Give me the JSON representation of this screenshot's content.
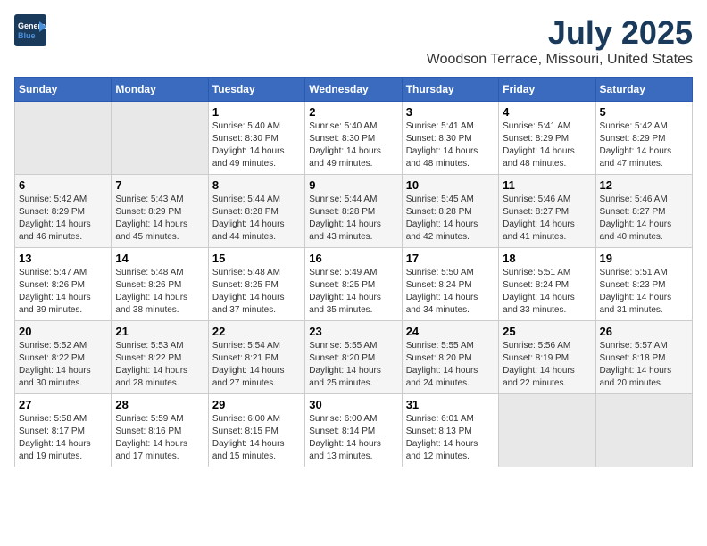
{
  "header": {
    "logo_line1": "General",
    "logo_line2": "Blue",
    "month_title": "July 2025",
    "location": "Woodson Terrace, Missouri, United States"
  },
  "days_of_week": [
    "Sunday",
    "Monday",
    "Tuesday",
    "Wednesday",
    "Thursday",
    "Friday",
    "Saturday"
  ],
  "weeks": [
    [
      {
        "day": "",
        "info": ""
      },
      {
        "day": "",
        "info": ""
      },
      {
        "day": "1",
        "info": "Sunrise: 5:40 AM\nSunset: 8:30 PM\nDaylight: 14 hours and 49 minutes."
      },
      {
        "day": "2",
        "info": "Sunrise: 5:40 AM\nSunset: 8:30 PM\nDaylight: 14 hours and 49 minutes."
      },
      {
        "day": "3",
        "info": "Sunrise: 5:41 AM\nSunset: 8:30 PM\nDaylight: 14 hours and 48 minutes."
      },
      {
        "day": "4",
        "info": "Sunrise: 5:41 AM\nSunset: 8:29 PM\nDaylight: 14 hours and 48 minutes."
      },
      {
        "day": "5",
        "info": "Sunrise: 5:42 AM\nSunset: 8:29 PM\nDaylight: 14 hours and 47 minutes."
      }
    ],
    [
      {
        "day": "6",
        "info": "Sunrise: 5:42 AM\nSunset: 8:29 PM\nDaylight: 14 hours and 46 minutes."
      },
      {
        "day": "7",
        "info": "Sunrise: 5:43 AM\nSunset: 8:29 PM\nDaylight: 14 hours and 45 minutes."
      },
      {
        "day": "8",
        "info": "Sunrise: 5:44 AM\nSunset: 8:28 PM\nDaylight: 14 hours and 44 minutes."
      },
      {
        "day": "9",
        "info": "Sunrise: 5:44 AM\nSunset: 8:28 PM\nDaylight: 14 hours and 43 minutes."
      },
      {
        "day": "10",
        "info": "Sunrise: 5:45 AM\nSunset: 8:28 PM\nDaylight: 14 hours and 42 minutes."
      },
      {
        "day": "11",
        "info": "Sunrise: 5:46 AM\nSunset: 8:27 PM\nDaylight: 14 hours and 41 minutes."
      },
      {
        "day": "12",
        "info": "Sunrise: 5:46 AM\nSunset: 8:27 PM\nDaylight: 14 hours and 40 minutes."
      }
    ],
    [
      {
        "day": "13",
        "info": "Sunrise: 5:47 AM\nSunset: 8:26 PM\nDaylight: 14 hours and 39 minutes."
      },
      {
        "day": "14",
        "info": "Sunrise: 5:48 AM\nSunset: 8:26 PM\nDaylight: 14 hours and 38 minutes."
      },
      {
        "day": "15",
        "info": "Sunrise: 5:48 AM\nSunset: 8:25 PM\nDaylight: 14 hours and 37 minutes."
      },
      {
        "day": "16",
        "info": "Sunrise: 5:49 AM\nSunset: 8:25 PM\nDaylight: 14 hours and 35 minutes."
      },
      {
        "day": "17",
        "info": "Sunrise: 5:50 AM\nSunset: 8:24 PM\nDaylight: 14 hours and 34 minutes."
      },
      {
        "day": "18",
        "info": "Sunrise: 5:51 AM\nSunset: 8:24 PM\nDaylight: 14 hours and 33 minutes."
      },
      {
        "day": "19",
        "info": "Sunrise: 5:51 AM\nSunset: 8:23 PM\nDaylight: 14 hours and 31 minutes."
      }
    ],
    [
      {
        "day": "20",
        "info": "Sunrise: 5:52 AM\nSunset: 8:22 PM\nDaylight: 14 hours and 30 minutes."
      },
      {
        "day": "21",
        "info": "Sunrise: 5:53 AM\nSunset: 8:22 PM\nDaylight: 14 hours and 28 minutes."
      },
      {
        "day": "22",
        "info": "Sunrise: 5:54 AM\nSunset: 8:21 PM\nDaylight: 14 hours and 27 minutes."
      },
      {
        "day": "23",
        "info": "Sunrise: 5:55 AM\nSunset: 8:20 PM\nDaylight: 14 hours and 25 minutes."
      },
      {
        "day": "24",
        "info": "Sunrise: 5:55 AM\nSunset: 8:20 PM\nDaylight: 14 hours and 24 minutes."
      },
      {
        "day": "25",
        "info": "Sunrise: 5:56 AM\nSunset: 8:19 PM\nDaylight: 14 hours and 22 minutes."
      },
      {
        "day": "26",
        "info": "Sunrise: 5:57 AM\nSunset: 8:18 PM\nDaylight: 14 hours and 20 minutes."
      }
    ],
    [
      {
        "day": "27",
        "info": "Sunrise: 5:58 AM\nSunset: 8:17 PM\nDaylight: 14 hours and 19 minutes."
      },
      {
        "day": "28",
        "info": "Sunrise: 5:59 AM\nSunset: 8:16 PM\nDaylight: 14 hours and 17 minutes."
      },
      {
        "day": "29",
        "info": "Sunrise: 6:00 AM\nSunset: 8:15 PM\nDaylight: 14 hours and 15 minutes."
      },
      {
        "day": "30",
        "info": "Sunrise: 6:00 AM\nSunset: 8:14 PM\nDaylight: 14 hours and 13 minutes."
      },
      {
        "day": "31",
        "info": "Sunrise: 6:01 AM\nSunset: 8:13 PM\nDaylight: 14 hours and 12 minutes."
      },
      {
        "day": "",
        "info": ""
      },
      {
        "day": "",
        "info": ""
      }
    ]
  ]
}
